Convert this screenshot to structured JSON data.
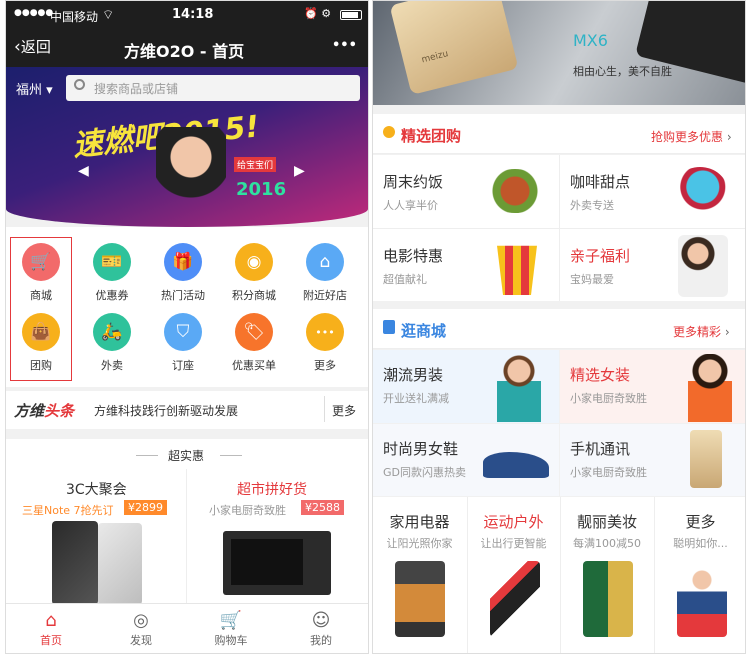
{
  "left": {
    "status": {
      "signal": "●●●●●",
      "carrier": "中国移动",
      "time": "14:18",
      "icons": "⏰ ⚙"
    },
    "nav": {
      "back": "返回",
      "title": "方维O2O - 首页",
      "more": "•••"
    },
    "search": {
      "city": "福州",
      "placeholder": "搜索商品或店铺"
    },
    "banner": {
      "headline": "速燃吧2015!",
      "year": "2016",
      "tag": "给宝宝们"
    },
    "grid": [
      {
        "label": "商城",
        "icon": "cart-icon",
        "color": "#f26a6a"
      },
      {
        "label": "优惠券",
        "icon": "coupon-icon",
        "color": "#2fc29b"
      },
      {
        "label": "热门活动",
        "icon": "gift-icon",
        "color": "#4f8ef7"
      },
      {
        "label": "积分商城",
        "icon": "coins-icon",
        "color": "#f7b01b"
      },
      {
        "label": "附近好店",
        "icon": "store-icon",
        "color": "#5aa9f5"
      },
      {
        "label": "团购",
        "icon": "bag-icon",
        "color": "#f7b01b"
      },
      {
        "label": "外卖",
        "icon": "scooter-icon",
        "color": "#2fc29b"
      },
      {
        "label": "订座",
        "icon": "seat-icon",
        "color": "#5aa9f5"
      },
      {
        "label": "优惠买单",
        "icon": "tag-icon",
        "color": "#f7742b"
      },
      {
        "label": "更多",
        "icon": "more-dots-icon",
        "color": "#f7b01b"
      }
    ],
    "headline": {
      "logo_a": "方维",
      "logo_b": "头条",
      "text": "方维科技践行创新驱动发展",
      "more": "更多"
    },
    "deals": {
      "title": "超实惠",
      "items": [
        {
          "title": "3C大聚会",
          "sub": "三星Note 7抢先订",
          "price": "¥2899"
        },
        {
          "title": "超市拼好货",
          "sub": "小家电厨奇致胜",
          "price": "¥2588"
        }
      ]
    },
    "tabbar": [
      {
        "label": "首页",
        "icon": "home-icon",
        "active": true
      },
      {
        "label": "发现",
        "icon": "compass-icon",
        "active": false
      },
      {
        "label": "购物车",
        "icon": "cart-icon",
        "active": false
      },
      {
        "label": "我的",
        "icon": "user-icon",
        "active": false
      }
    ]
  },
  "right": {
    "banner": {
      "brand": "MX6",
      "slogan": "相由心生，美不自胜",
      "phone": "meizu"
    },
    "group": {
      "title": "精选团购",
      "more": "抢购更多优惠",
      "cells": [
        {
          "title": "周末约饭",
          "sub": "人人享半价"
        },
        {
          "title": "咖啡甜点",
          "sub": "外卖专送"
        },
        {
          "title": "电影特惠",
          "sub": "超值献礼"
        },
        {
          "title": "亲子福利",
          "sub": "宝妈最爱"
        }
      ]
    },
    "mall": {
      "title": "逛商城",
      "more": "更多精彩",
      "cells": [
        {
          "title": "潮流男装",
          "sub": "开业送礼满减"
        },
        {
          "title": "精选女装",
          "sub": "小家电厨奇致胜"
        },
        {
          "title": "时尚男女鞋",
          "sub": "GD同款闪惠热卖"
        },
        {
          "title": "手机通讯",
          "sub": "小家电厨奇致胜"
        }
      ],
      "bottom": [
        {
          "title": "家用电器",
          "sub": "让阳光照你家"
        },
        {
          "title": "运动户外",
          "sub": "让出行更智能"
        },
        {
          "title": "靓丽美妆",
          "sub": "每满100减50"
        },
        {
          "title": "更多",
          "sub": "聪明如你..."
        }
      ]
    }
  },
  "colors": {
    "accent": "#e4393c",
    "price_bg": "#ff8a2b",
    "price_bg2": "#f26a6a"
  }
}
